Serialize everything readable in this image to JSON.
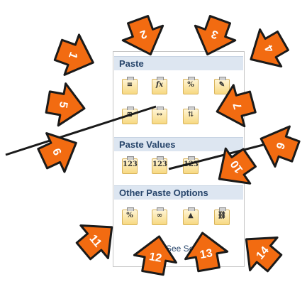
{
  "menu": {
    "section_paste": "Paste",
    "section_values": "Paste Values",
    "section_other": "Other Paste Options",
    "see_more": "See Se... "
  },
  "callouts": [
    {
      "number": "1"
    },
    {
      "number": "2"
    },
    {
      "number": "3"
    },
    {
      "number": "4"
    },
    {
      "number": "5"
    },
    {
      "number": "6"
    },
    {
      "number": "7"
    },
    {
      "number": "8"
    },
    {
      "number": "9"
    },
    {
      "number": "10"
    },
    {
      "number": "11"
    },
    {
      "number": "12"
    },
    {
      "number": "13"
    },
    {
      "number": "14"
    }
  ],
  "colors": {
    "arrow_fill": "#f26b11",
    "arrow_stroke": "#1a1a1a",
    "header_bg": "#dde6f1"
  }
}
